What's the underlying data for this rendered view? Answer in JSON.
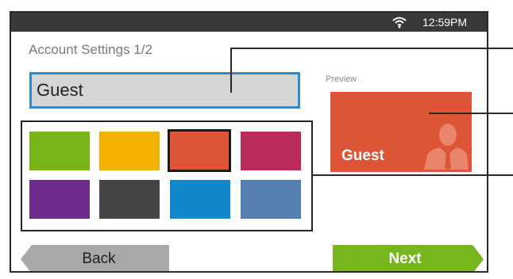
{
  "status_bar": {
    "time": "12:59PM",
    "wifi_icon": "wifi-icon",
    "background": "#383838"
  },
  "header": {
    "title": "Account Settings 1/2"
  },
  "name_input": {
    "value": "Guest"
  },
  "color_palette": {
    "selected_index": 2,
    "swatches": [
      "#79b417",
      "#f2b000",
      "#dd5536",
      "#bd2a5c",
      "#6d2c8e",
      "#454545",
      "#1388cc",
      "#5380b0"
    ]
  },
  "preview": {
    "label": "Preview",
    "name": "Guest",
    "tile_color": "#dd5536",
    "avatar_icon": "person-silhouette-icon"
  },
  "footer": {
    "back_label": "Back",
    "back_color": "#a9a9a9",
    "next_label": "Next",
    "next_color": "#76b51c"
  }
}
